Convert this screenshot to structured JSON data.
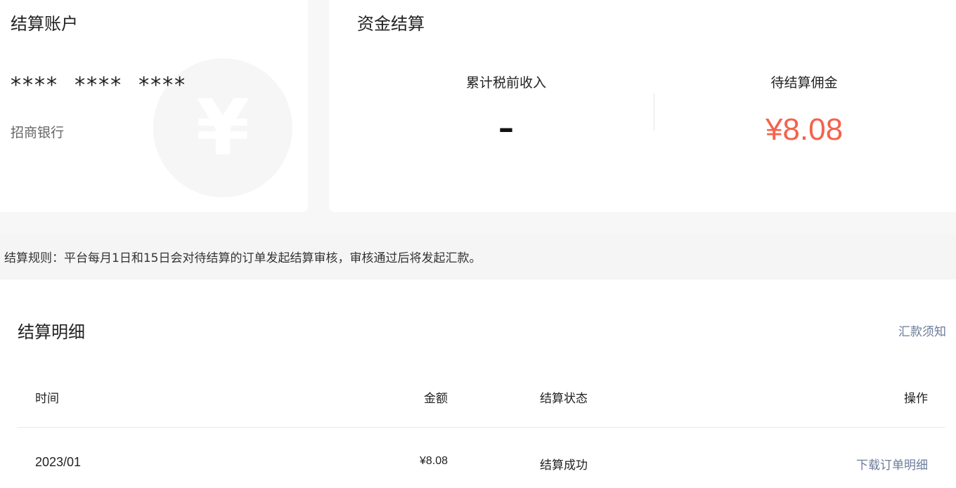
{
  "account_card": {
    "title": "结算账户",
    "account_number": "****  ****  ****",
    "bank_name": "招商银行",
    "background_icon": "yen-icon",
    "background_glyph": "¥"
  },
  "funds_card": {
    "title": "资金结算",
    "cumulative_income_label": "累计税前收入",
    "cumulative_income_value": "–",
    "pending_commission_label": "待结算佣金",
    "pending_commission_value": "¥8.08",
    "accent_color": "#f5624c"
  },
  "rule": {
    "text": "结算规则：平台每月1日和15日会对待结算的订单发起结算审核，审核通过后将发起汇款。"
  },
  "details": {
    "title": "结算明细",
    "notice_link": "汇款须知",
    "link_color": "#6b7b99",
    "columns": {
      "time": "时间",
      "amount": "金额",
      "status": "结算状态",
      "action": "操作"
    },
    "rows": [
      {
        "time": "2023/01",
        "amount": "¥8.08",
        "status": "结算成功",
        "action": "下载订单明细"
      }
    ]
  }
}
